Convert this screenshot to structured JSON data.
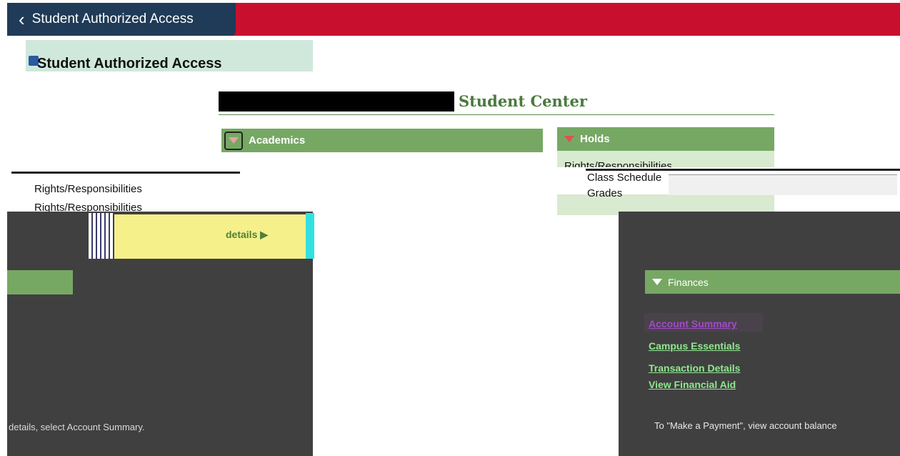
{
  "header": {
    "back_label": "Student Authorized Access"
  },
  "left_panel": {
    "title": "Student Authorized Access"
  },
  "center": {
    "title": "Student Center"
  },
  "sections": {
    "academics": "Academics",
    "holds": "Holds",
    "finances": "Finances"
  },
  "dropdown": {
    "items": [
      "Rights/Responsibilities",
      "Rights/Responsibilities"
    ],
    "right_items": [
      "Class Schedule",
      "Grades"
    ]
  },
  "holds": {
    "row": "Rights/Responsibilities"
  },
  "details": {
    "label": "details ▶"
  },
  "finance_links": [
    "Account Summary",
    "Campus Essentials",
    "Transaction Details",
    "View Financial Aid"
  ],
  "notes": {
    "left": "details, select Account Summary.",
    "right": "To \"Make a Payment\", view account balance"
  },
  "colors": {
    "banner": "#c8102e",
    "back_button": "#1f3b57",
    "section_green": "#76a864",
    "overlay_dark": "#404040"
  }
}
